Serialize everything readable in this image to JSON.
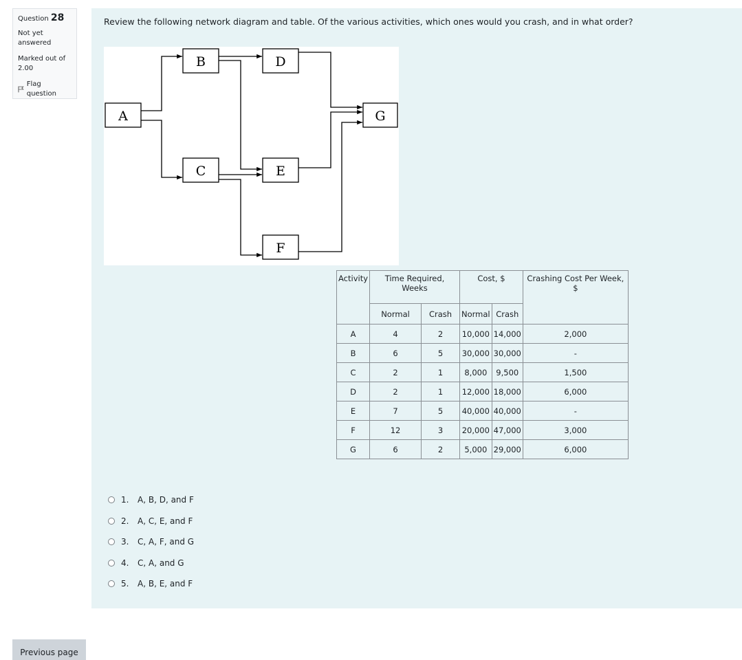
{
  "question_info": {
    "label": "Question",
    "number": "28",
    "state": "Not yet answered",
    "grade": "Marked out of 2.00",
    "flag_label": "Flag question"
  },
  "question_text": "Review the following network diagram and table. Of the various activities, which ones would you crash, and in what order?",
  "diagram": {
    "nodes": [
      "A",
      "B",
      "C",
      "D",
      "E",
      "F",
      "G"
    ]
  },
  "table": {
    "headers": {
      "activity": "Activity",
      "time": "Time Required, Weeks",
      "cost": "Cost, $",
      "crash_cost": "Crashing Cost Per Week, $",
      "normal": "Normal",
      "crash": "Crash"
    },
    "rows": [
      [
        "A",
        "4",
        "2",
        "10,000",
        "14,000",
        "2,000"
      ],
      [
        "B",
        "6",
        "5",
        "30,000",
        "30,000",
        "-"
      ],
      [
        "C",
        "2",
        "1",
        "8,000",
        "9,500",
        "1,500"
      ],
      [
        "D",
        "2",
        "1",
        "12,000",
        "18,000",
        "6,000"
      ],
      [
        "E",
        "7",
        "5",
        "40,000",
        "40,000",
        "-"
      ],
      [
        "F",
        "12",
        "3",
        "20,000",
        "47,000",
        "3,000"
      ],
      [
        "G",
        "6",
        "2",
        "5,000",
        "29,000",
        "6,000"
      ]
    ]
  },
  "answers": [
    {
      "num": "1.",
      "text": "A, B, D, and F"
    },
    {
      "num": "2.",
      "text": "A, C, E, and F"
    },
    {
      "num": "3.",
      "text": "C, A, F, and G"
    },
    {
      "num": "4.",
      "text": "C, A, and G"
    },
    {
      "num": "5.",
      "text": "A, B, E, and F"
    }
  ],
  "nav": {
    "previous_label": "Previous page"
  }
}
